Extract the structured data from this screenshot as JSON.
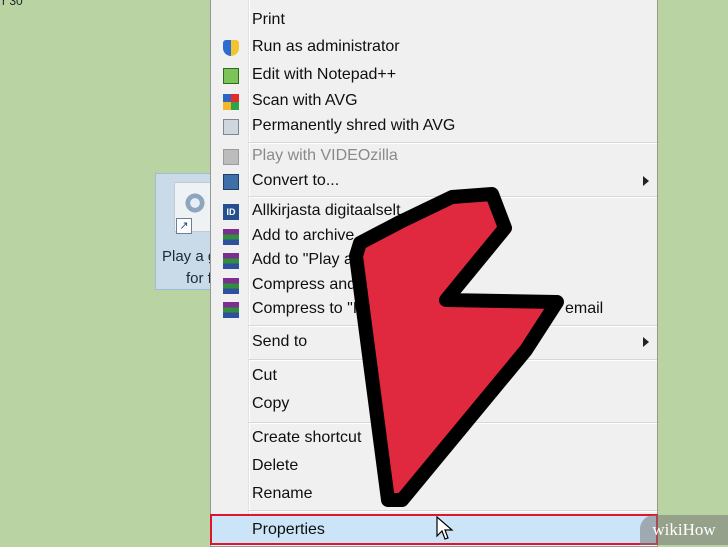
{
  "desktop": {
    "top_text": "r 30",
    "icon_label_line1": "Play a g",
    "icon_label_line2": "for f"
  },
  "context_menu": {
    "items": [
      {
        "label": "Print",
        "icon": "none"
      },
      {
        "label": "Run as administrator",
        "icon": "uac-shield-icon"
      },
      {
        "label": "Edit with Notepad++",
        "icon": "notepad-plus-icon"
      },
      {
        "label": "Scan with AVG",
        "icon": "avg-icon"
      },
      {
        "label": "Permanently shred with AVG",
        "icon": "shredder-icon"
      },
      {
        "label": "Play with VIDEOzilla",
        "icon": "videozilla-icon",
        "disabled": true
      },
      {
        "label": "Convert to...",
        "icon": "convert-icon",
        "submenu": true
      },
      {
        "label": "Allkirjasta digitaalselt",
        "icon": "digital-signature-icon"
      },
      {
        "label": "Add to archive...",
        "icon": "winrar-icon"
      },
      {
        "label": "Add to \"Play a game for f",
        "icon": "winrar-icon"
      },
      {
        "label": "Compress and",
        "icon": "winrar-icon"
      },
      {
        "label": "Compress to \"P",
        "icon": "winrar-icon",
        "trailing_text": "email"
      },
      {
        "label": "Send to",
        "icon": "none",
        "submenu": true
      },
      {
        "label": "Cut",
        "icon": "none"
      },
      {
        "label": "Copy",
        "icon": "none"
      },
      {
        "label": "Create shortcut",
        "icon": "none"
      },
      {
        "label": "Delete",
        "icon": "none"
      },
      {
        "label": "Rename",
        "icon": "none"
      },
      {
        "label": "Properties",
        "icon": "none",
        "highlighted": true
      }
    ]
  },
  "overlay": {
    "arrow_color": "#e0283e",
    "highlight_color": "#e0142a"
  },
  "watermark": {
    "text": "wikiHow"
  }
}
